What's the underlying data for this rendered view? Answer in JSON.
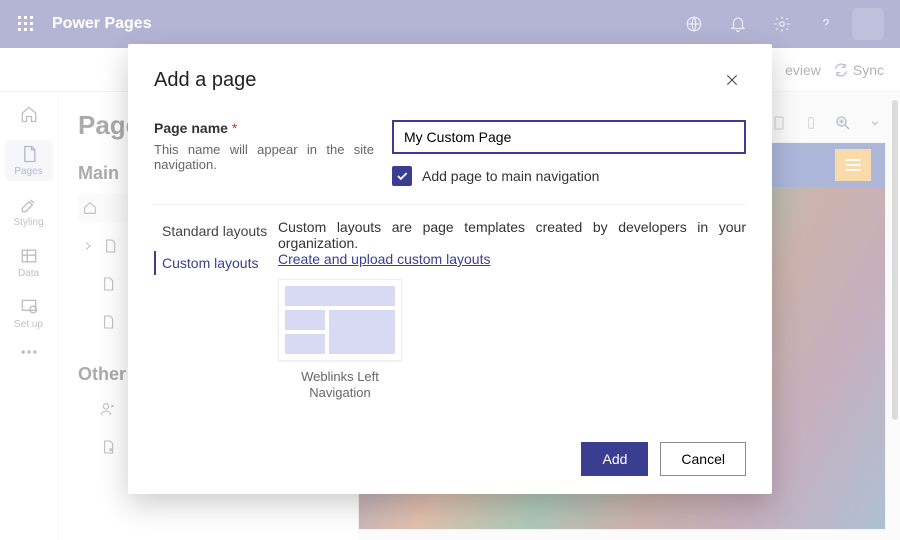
{
  "app": {
    "title": "Power Pages"
  },
  "appbar_icons": {
    "globe": "globe-icon",
    "bell": "bell-icon",
    "gear": "gear-icon",
    "help": "help-icon"
  },
  "cmdbar": {
    "preview": "eview",
    "sync": "Sync"
  },
  "leftrail": [
    {
      "id": "home",
      "label": ""
    },
    {
      "id": "pages",
      "label": "Pages"
    },
    {
      "id": "styling",
      "label": "Styling"
    },
    {
      "id": "data",
      "label": "Data"
    },
    {
      "id": "setup",
      "label": "Set up"
    }
  ],
  "panel": {
    "title": "Page",
    "main_section": "Main ",
    "other_section": "Other",
    "tree": [
      {
        "icon": "home",
        "label": ""
      },
      {
        "icon": "page",
        "label": "",
        "chevron": true
      },
      {
        "icon": "page",
        "label": ""
      },
      {
        "icon": "page",
        "label": ""
      }
    ],
    "other_tree": [
      {
        "icon": "person",
        "label": ""
      },
      {
        "icon": "page-plus",
        "label": ""
      }
    ]
  },
  "toolbar": {
    "zoom_suffix": ""
  },
  "modal": {
    "title": "Add a page",
    "page_name_label": "Page name",
    "required_mark": "*",
    "page_name_hint": "This name will appear in the site navigation.",
    "page_name_value": "My Custom Page",
    "add_to_nav_label": "Add page to main navigation",
    "add_to_nav_checked": true,
    "tabs": {
      "standard": "Standard layouts",
      "custom": "Custom layouts"
    },
    "custom_desc": "Custom layouts are page templates created by developers in your organization.",
    "custom_link": "Create and upload custom layouts",
    "templates": [
      {
        "name": "Weblinks Left Navigation"
      }
    ],
    "add_btn": "Add",
    "cancel_btn": "Cancel"
  }
}
